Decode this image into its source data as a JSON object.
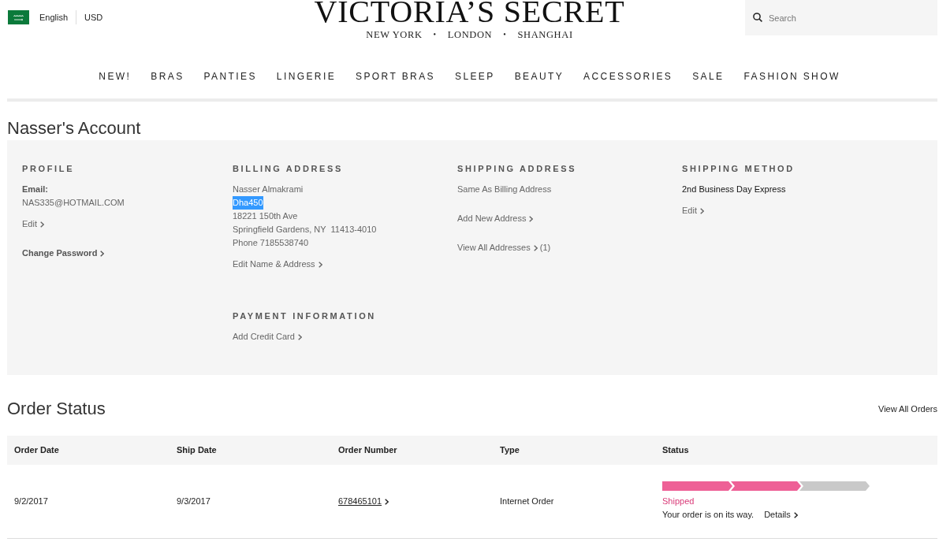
{
  "header": {
    "language": "English",
    "currency": "USD",
    "logo": "VICTORIA’S SECRET",
    "tagline": [
      {
        "kind": "city",
        "text": "NEW YORK"
      },
      {
        "kind": "separator",
        "text": "•"
      },
      {
        "kind": "city",
        "text": "LONDON"
      },
      {
        "kind": "separator",
        "text": "•"
      },
      {
        "kind": "city",
        "text": "SHANGHAI"
      }
    ],
    "search": {
      "placeholder": "Search"
    }
  },
  "nav": [
    "NEW!",
    "BRAS",
    "PANTIES",
    "LINGERIE",
    "SPORT BRAS",
    "SLEEP",
    "BEAUTY",
    "ACCESSORIES",
    "SALE",
    "FASHION SHOW"
  ],
  "account": {
    "title": "Nasser's Account",
    "profile": {
      "heading": "PROFILE",
      "email_label": "Email:",
      "email": "NAS335@HOTMAIL.COM",
      "edit_link": "Edit",
      "change_password_link": "Change Password"
    },
    "billing_address": {
      "heading": "BILLING ADDRESS",
      "lines": [
        {
          "text": "Nasser Almakrami",
          "highlighted": false
        },
        {
          "text": "Dha450",
          "highlighted": true
        },
        {
          "text": "18221 150th Ave",
          "highlighted": false
        },
        {
          "text": "Springfield Gardens, NY  11413-4010",
          "highlighted": false
        },
        {
          "text": "Phone 7185538740",
          "highlighted": false
        }
      ],
      "edit_link": "Edit Name & Address"
    },
    "payment_information": {
      "heading": "PAYMENT INFORMATION",
      "add_link": "Add Credit Card"
    },
    "shipping_address": {
      "heading": "SHIPPING ADDRESS",
      "summary": "Same As Billing Address",
      "add_link": "Add New Address",
      "view_all_link": "View All Addresses",
      "count": "(1)"
    },
    "shipping_method": {
      "heading": "SHIPPING METHOD",
      "value": "2nd Business Day Express",
      "edit_link": "Edit"
    }
  },
  "order_status": {
    "title": "Order Status",
    "view_all_link": "View All Orders",
    "table": {
      "columns": [
        "Order Date",
        "Ship Date",
        "Order Number",
        "Type",
        "Status"
      ],
      "rows": [
        {
          "order_date": "9/2/2017",
          "ship_date": "9/3/2017",
          "order_number": "678465101",
          "type": "Internet Order",
          "status": {
            "steps": [
              {
                "complete": true
              },
              {
                "complete": true
              },
              {
                "complete": false
              }
            ],
            "label": "Shipped",
            "message": "Your order is on its way.",
            "details_link": "Details"
          }
        }
      ]
    }
  }
}
